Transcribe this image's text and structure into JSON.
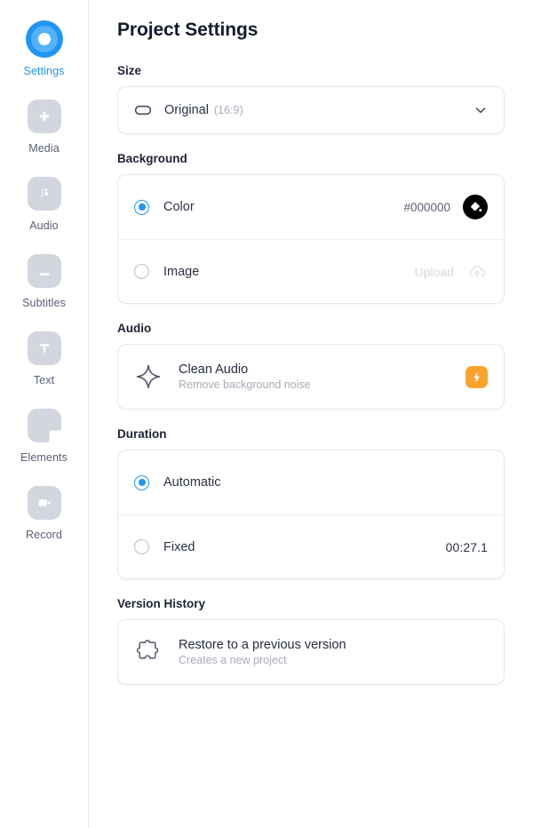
{
  "sidebar": {
    "items": [
      {
        "label": "Settings",
        "icon": "settings-target-icon",
        "active": true
      },
      {
        "label": "Media",
        "icon": "plus-icon",
        "active": false
      },
      {
        "label": "Audio",
        "icon": "music-note-icon",
        "active": false
      },
      {
        "label": "Subtitles",
        "icon": "subtitles-icon",
        "active": false
      },
      {
        "label": "Text",
        "icon": "text-t-icon",
        "active": false
      },
      {
        "label": "Elements",
        "icon": "elements-shape-icon",
        "active": false
      },
      {
        "label": "Record",
        "icon": "video-camera-icon",
        "active": false
      }
    ]
  },
  "header": {
    "title": "Project Settings"
  },
  "size": {
    "label": "Size",
    "icon": "aspect-ratio-icon",
    "value": "Original",
    "ratio": "(16:9)",
    "chevron": "chevron-down-icon"
  },
  "background": {
    "label": "Background",
    "color_option": {
      "label": "Color",
      "selected": true,
      "value": "#000000",
      "swatch_icon": "paint-bucket-icon",
      "swatch_color": "#000000"
    },
    "image_option": {
      "label": "Image",
      "selected": false,
      "action": "Upload",
      "icon": "cloud-upload-icon"
    }
  },
  "audio": {
    "label": "Audio",
    "clean_audio": {
      "icon": "sparkle-icon",
      "title": "Clean Audio",
      "subtitle": "Remove background noise",
      "badge_icon": "lightning-bolt-icon",
      "badge_color": "#f9a32e"
    }
  },
  "duration": {
    "label": "Duration",
    "automatic": {
      "label": "Automatic",
      "selected": true
    },
    "fixed": {
      "label": "Fixed",
      "selected": false,
      "value": "00:27.1"
    }
  },
  "version_history": {
    "label": "Version History",
    "restore": {
      "icon": "puzzle-piece-icon",
      "title": "Restore to a previous version",
      "subtitle": "Creates a new project"
    }
  },
  "colors": {
    "accent": "#1f96f5",
    "warning": "#f9a32e",
    "tile": "#d3d6de"
  }
}
